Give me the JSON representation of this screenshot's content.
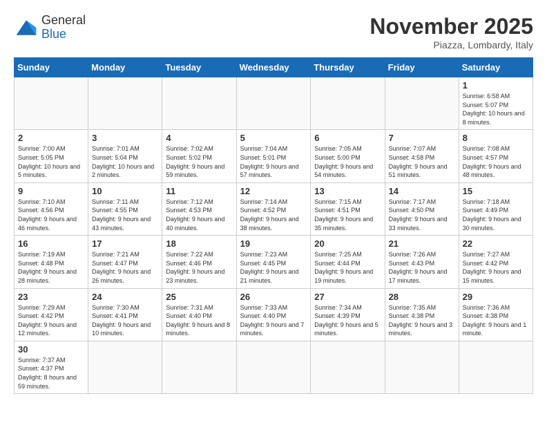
{
  "logo": {
    "line1": "General",
    "line2": "Blue"
  },
  "title": "November 2025",
  "location": "Piazza, Lombardy, Italy",
  "days_of_week": [
    "Sunday",
    "Monday",
    "Tuesday",
    "Wednesday",
    "Thursday",
    "Friday",
    "Saturday"
  ],
  "weeks": [
    [
      {
        "day": "",
        "info": ""
      },
      {
        "day": "",
        "info": ""
      },
      {
        "day": "",
        "info": ""
      },
      {
        "day": "",
        "info": ""
      },
      {
        "day": "",
        "info": ""
      },
      {
        "day": "",
        "info": ""
      },
      {
        "day": "1",
        "info": "Sunrise: 6:58 AM\nSunset: 5:07 PM\nDaylight: 10 hours and 8 minutes."
      }
    ],
    [
      {
        "day": "2",
        "info": "Sunrise: 7:00 AM\nSunset: 5:05 PM\nDaylight: 10 hours and 5 minutes."
      },
      {
        "day": "3",
        "info": "Sunrise: 7:01 AM\nSunset: 5:04 PM\nDaylight: 10 hours and 2 minutes."
      },
      {
        "day": "4",
        "info": "Sunrise: 7:02 AM\nSunset: 5:02 PM\nDaylight: 9 hours and 59 minutes."
      },
      {
        "day": "5",
        "info": "Sunrise: 7:04 AM\nSunset: 5:01 PM\nDaylight: 9 hours and 57 minutes."
      },
      {
        "day": "6",
        "info": "Sunrise: 7:05 AM\nSunset: 5:00 PM\nDaylight: 9 hours and 54 minutes."
      },
      {
        "day": "7",
        "info": "Sunrise: 7:07 AM\nSunset: 4:58 PM\nDaylight: 9 hours and 51 minutes."
      },
      {
        "day": "8",
        "info": "Sunrise: 7:08 AM\nSunset: 4:57 PM\nDaylight: 9 hours and 48 minutes."
      }
    ],
    [
      {
        "day": "9",
        "info": "Sunrise: 7:10 AM\nSunset: 4:56 PM\nDaylight: 9 hours and 46 minutes."
      },
      {
        "day": "10",
        "info": "Sunrise: 7:11 AM\nSunset: 4:55 PM\nDaylight: 9 hours and 43 minutes."
      },
      {
        "day": "11",
        "info": "Sunrise: 7:12 AM\nSunset: 4:53 PM\nDaylight: 9 hours and 40 minutes."
      },
      {
        "day": "12",
        "info": "Sunrise: 7:14 AM\nSunset: 4:52 PM\nDaylight: 9 hours and 38 minutes."
      },
      {
        "day": "13",
        "info": "Sunrise: 7:15 AM\nSunset: 4:51 PM\nDaylight: 9 hours and 35 minutes."
      },
      {
        "day": "14",
        "info": "Sunrise: 7:17 AM\nSunset: 4:50 PM\nDaylight: 9 hours and 33 minutes."
      },
      {
        "day": "15",
        "info": "Sunrise: 7:18 AM\nSunset: 4:49 PM\nDaylight: 9 hours and 30 minutes."
      }
    ],
    [
      {
        "day": "16",
        "info": "Sunrise: 7:19 AM\nSunset: 4:48 PM\nDaylight: 9 hours and 28 minutes."
      },
      {
        "day": "17",
        "info": "Sunrise: 7:21 AM\nSunset: 4:47 PM\nDaylight: 9 hours and 26 minutes."
      },
      {
        "day": "18",
        "info": "Sunrise: 7:22 AM\nSunset: 4:46 PM\nDaylight: 9 hours and 23 minutes."
      },
      {
        "day": "19",
        "info": "Sunrise: 7:23 AM\nSunset: 4:45 PM\nDaylight: 9 hours and 21 minutes."
      },
      {
        "day": "20",
        "info": "Sunrise: 7:25 AM\nSunset: 4:44 PM\nDaylight: 9 hours and 19 minutes."
      },
      {
        "day": "21",
        "info": "Sunrise: 7:26 AM\nSunset: 4:43 PM\nDaylight: 9 hours and 17 minutes."
      },
      {
        "day": "22",
        "info": "Sunrise: 7:27 AM\nSunset: 4:42 PM\nDaylight: 9 hours and 15 minutes."
      }
    ],
    [
      {
        "day": "23",
        "info": "Sunrise: 7:29 AM\nSunset: 4:42 PM\nDaylight: 9 hours and 12 minutes."
      },
      {
        "day": "24",
        "info": "Sunrise: 7:30 AM\nSunset: 4:41 PM\nDaylight: 9 hours and 10 minutes."
      },
      {
        "day": "25",
        "info": "Sunrise: 7:31 AM\nSunset: 4:40 PM\nDaylight: 9 hours and 8 minutes."
      },
      {
        "day": "26",
        "info": "Sunrise: 7:33 AM\nSunset: 4:40 PM\nDaylight: 9 hours and 7 minutes."
      },
      {
        "day": "27",
        "info": "Sunrise: 7:34 AM\nSunset: 4:39 PM\nDaylight: 9 hours and 5 minutes."
      },
      {
        "day": "28",
        "info": "Sunrise: 7:35 AM\nSunset: 4:38 PM\nDaylight: 9 hours and 3 minutes."
      },
      {
        "day": "29",
        "info": "Sunrise: 7:36 AM\nSunset: 4:38 PM\nDaylight: 9 hours and 1 minute."
      }
    ],
    [
      {
        "day": "30",
        "info": "Sunrise: 7:37 AM\nSunset: 4:37 PM\nDaylight: 8 hours and 59 minutes."
      },
      {
        "day": "",
        "info": ""
      },
      {
        "day": "",
        "info": ""
      },
      {
        "day": "",
        "info": ""
      },
      {
        "day": "",
        "info": ""
      },
      {
        "day": "",
        "info": ""
      },
      {
        "day": "",
        "info": ""
      }
    ]
  ]
}
